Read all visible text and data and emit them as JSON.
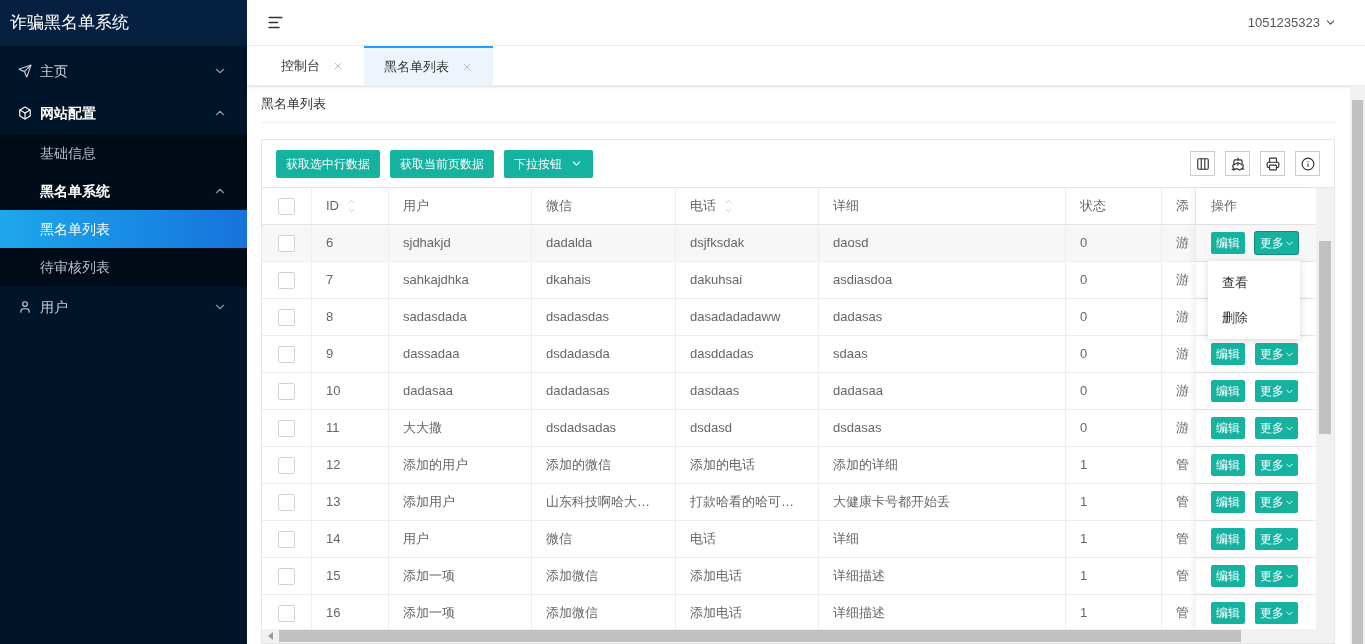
{
  "sidebar": {
    "title": "诈骗黑名单系统",
    "items": [
      {
        "label": "主页",
        "expanded": false,
        "selected": false
      },
      {
        "label": "网站配置",
        "expanded": true,
        "selected": false,
        "children": [
          {
            "label": "基础信息",
            "selected": false
          },
          {
            "label": "黑名单系统",
            "expanded": true,
            "selected": false,
            "children": [
              {
                "label": "黑名单列表",
                "selected": true
              },
              {
                "label": "待审核列表",
                "selected": false
              }
            ]
          }
        ]
      },
      {
        "label": "用户",
        "expanded": false,
        "selected": false
      }
    ]
  },
  "header": {
    "user": "1051235323"
  },
  "tabs": [
    {
      "label": "控制台",
      "selected": false
    },
    {
      "label": "黑名单列表",
      "selected": true
    }
  ],
  "breadcrumb": "黑名单列表",
  "toolbar": {
    "buttons": [
      {
        "label": "获取选中行数据",
        "kind": "plain"
      },
      {
        "label": "获取当前页数据",
        "kind": "plain"
      },
      {
        "label": "下拉按钮",
        "kind": "dropdown"
      }
    ]
  },
  "table": {
    "header_checked": false,
    "columns": [
      {
        "label": "ID",
        "sortable": true
      },
      {
        "label": "用户",
        "sortable": false
      },
      {
        "label": "微信",
        "sortable": false
      },
      {
        "label": "电话",
        "sortable": true
      },
      {
        "label": "详细",
        "sortable": false
      },
      {
        "label": "状态",
        "sortable": false
      },
      {
        "label": "添"
      },
      {
        "label": "操作",
        "sortable": false
      }
    ],
    "rows": [
      {
        "checked": false,
        "cells": [
          "6",
          "sjdhakjd",
          "dadalda",
          "dsjfksdak",
          "daosd",
          "0",
          "游"
        ],
        "edit": "编辑",
        "more": "更多",
        "expanded": true
      },
      {
        "checked": false,
        "cells": [
          "7",
          "sahkajdhka",
          "dkahais",
          "dakuhsai",
          "asdiasdoa",
          "0",
          "游"
        ]
      },
      {
        "checked": false,
        "cells": [
          "8",
          "sadasdada",
          "dsadasdas",
          "dasadadadaww",
          "dadasas",
          "0",
          "游"
        ]
      },
      {
        "checked": false,
        "cells": [
          "9",
          "dassadaa",
          "dsdadasda",
          "dasddadas",
          "sdaas",
          "0",
          "游"
        ],
        "edit": "编辑",
        "more": "更多",
        "expanded": false
      },
      {
        "checked": false,
        "cells": [
          "10",
          "dadasaa",
          "dadadasas",
          "dasdaas",
          "dadasaa",
          "0",
          "游"
        ],
        "edit": "编辑",
        "more": "更多",
        "expanded": false
      },
      {
        "checked": false,
        "cells": [
          "11",
          "大大撒",
          "dsdadsadas",
          "dsdasd",
          "dsdasas",
          "0",
          "游"
        ],
        "edit": "编辑",
        "more": "更多",
        "expanded": false
      },
      {
        "checked": false,
        "cells": [
          "12",
          "添加的用户",
          "添加的微信",
          "添加的电话",
          "添加的详细",
          "1",
          "管"
        ],
        "edit": "编辑",
        "more": "更多",
        "expanded": false
      },
      {
        "checked": false,
        "cells": [
          "13",
          "添加用户",
          "山东科技啊哈大…",
          "打款哈看的哈可…",
          "大健康卡号都开始丢",
          "1",
          "管"
        ],
        "edit": "编辑",
        "more": "更多",
        "expanded": false
      },
      {
        "checked": false,
        "cells": [
          "14",
          "用户",
          "微信",
          "电话",
          "详细",
          "1",
          "管"
        ],
        "edit": "编辑",
        "more": "更多",
        "expanded": false
      },
      {
        "checked": false,
        "cells": [
          "15",
          "添加一项",
          "添加微信",
          "添加电话",
          "详细描述",
          "1",
          "管"
        ],
        "edit": "编辑",
        "more": "更多",
        "expanded": false
      },
      {
        "checked": false,
        "cells": [
          "16",
          "添加一项",
          "添加微信",
          "添加电话",
          "详细描述",
          "1",
          "管"
        ],
        "edit": "编辑",
        "more": "更多",
        "expanded": false
      }
    ],
    "more_menu": [
      "查看",
      "删除"
    ]
  }
}
